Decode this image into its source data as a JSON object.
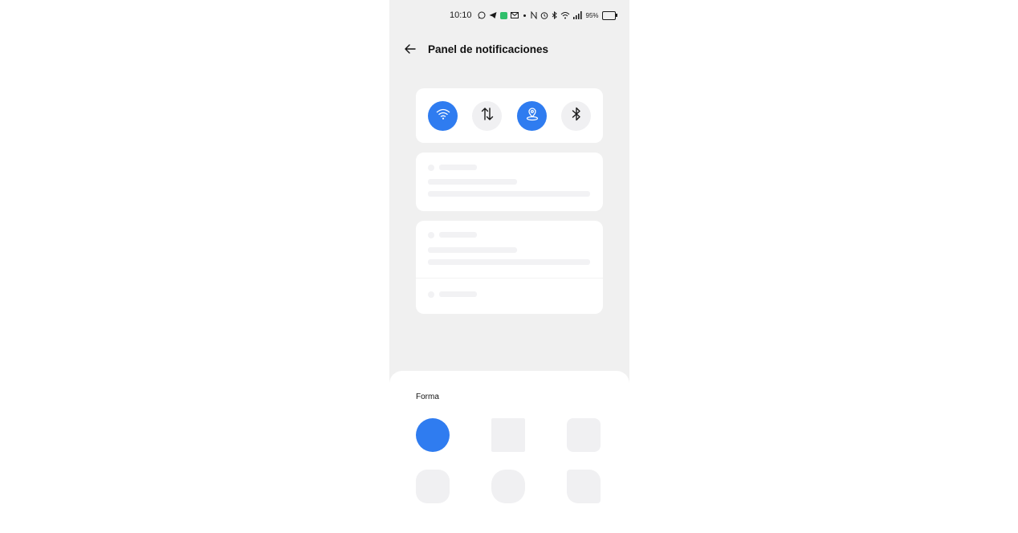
{
  "status_bar": {
    "time": "10:10",
    "battery": "95%",
    "battery_level": 0.95,
    "icons": [
      "whatsapp-icon",
      "telegram-icon",
      "green-app-icon",
      "mail-icon",
      "dot-icon",
      "nfc-icon",
      "alarm-icon",
      "bluetooth-icon",
      "wifi-icon",
      "signal-icon",
      "battery-icon"
    ]
  },
  "header": {
    "title": "Panel de notificaciones"
  },
  "quick_toggles": [
    {
      "name": "wifi",
      "icon": "wifi-icon",
      "active": true
    },
    {
      "name": "mobile-data",
      "icon": "data-arrows-icon",
      "active": false
    },
    {
      "name": "location",
      "icon": "location-icon",
      "active": true
    },
    {
      "name": "bluetooth",
      "icon": "bluetooth-icon",
      "active": false
    }
  ],
  "sheet": {
    "label": "Forma",
    "shapes": [
      {
        "name": "circle",
        "selected": true
      },
      {
        "name": "square",
        "selected": false
      },
      {
        "name": "rounded-square",
        "selected": false
      },
      {
        "name": "squircle",
        "selected": false
      },
      {
        "name": "pebble",
        "selected": false
      },
      {
        "name": "leaf",
        "selected": false
      }
    ]
  },
  "colors": {
    "accent": "#2f7cf0",
    "background": "#f0f0f0",
    "card": "#ffffff"
  }
}
